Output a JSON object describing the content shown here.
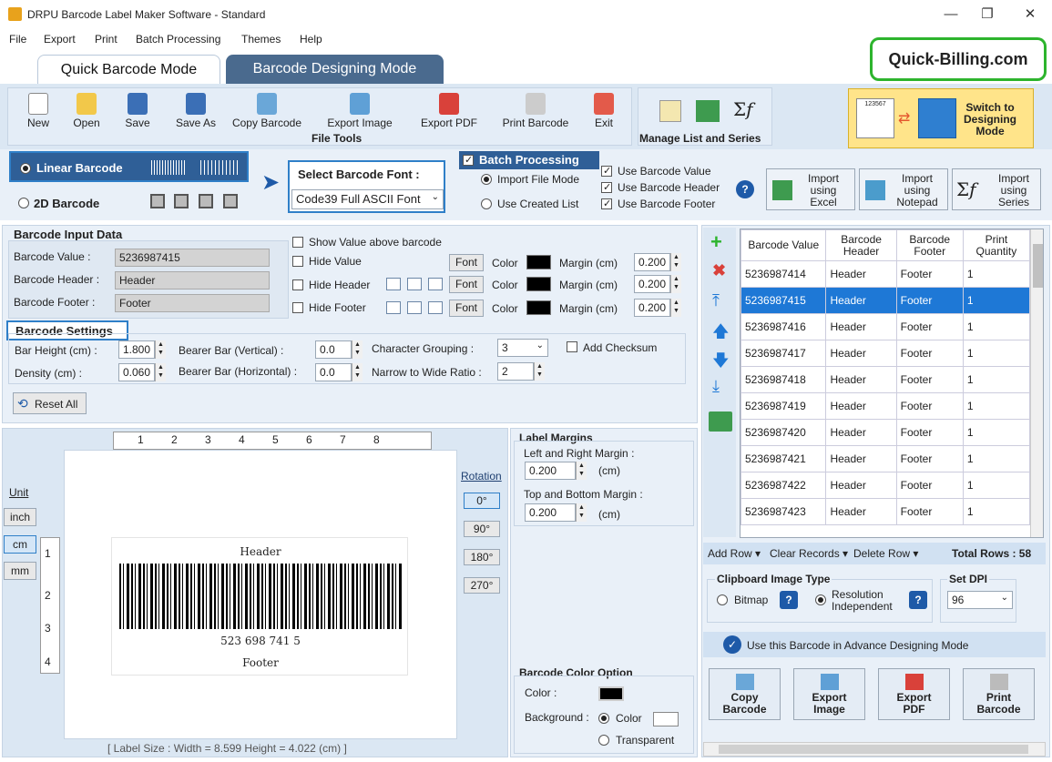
{
  "window": {
    "title": "DRPU Barcode Label Maker Software - Standard"
  },
  "menu": [
    "File",
    "Export",
    "Print",
    "Batch Processing",
    "Themes",
    "Help"
  ],
  "tabs": {
    "quick": "Quick Barcode Mode",
    "designing": "Barcode Designing Mode"
  },
  "brand": "Quick-Billing.com",
  "toolbar": {
    "file_tools": [
      "New",
      "Open",
      "Save",
      "Save As",
      "Copy Barcode",
      "Export Image",
      "Export PDF",
      "Print Barcode",
      "Exit"
    ],
    "file_tools_label": "File Tools",
    "manage_label": "Manage List and Series",
    "switch_label": "Switch to Designing Mode",
    "switch_thumb_value": "123567"
  },
  "type": {
    "linear": "Linear Barcode",
    "two_d": "2D Barcode",
    "selected": "Linear Barcode"
  },
  "font": {
    "label": "Select Barcode Font :",
    "value": "Code39 Full ASCII Font"
  },
  "batch": {
    "title": "Batch Processing",
    "import_file": "Import File Mode",
    "use_created": "Use Created List",
    "use_value": "Use Barcode Value",
    "use_header": "Use Barcode Header",
    "use_footer": "Use Barcode Footer",
    "help": "?",
    "import_excel": "Import using Excel",
    "import_notepad": "Import using Notepad",
    "import_series": "Import using Series"
  },
  "input": {
    "title": "Barcode Input Data",
    "value_label": "Barcode Value :",
    "value": "5236987415",
    "header_label": "Barcode Header :",
    "header": "Header",
    "footer_label": "Barcode Footer :",
    "footer": "Footer",
    "show_above": "Show Value above barcode",
    "hide_value": "Hide Value",
    "hide_header": "Hide Header",
    "hide_footer": "Hide Footer",
    "font_btn": "Font",
    "color_lbl": "Color",
    "margin_lbl": "Margin (cm)",
    "margins": [
      "0.200",
      "0.200",
      "0.200"
    ]
  },
  "settings": {
    "title": "Barcode Settings",
    "bar_height_lbl": "Bar Height (cm) :",
    "bar_height": "1.800",
    "density_lbl": "Density (cm) :",
    "density": "0.060",
    "bearer_v_lbl": "Bearer Bar (Vertical) :",
    "bearer_v": "0.0",
    "bearer_h_lbl": "Bearer Bar (Horizontal) :",
    "bearer_h": "0.0",
    "grouping_lbl": "Character Grouping :",
    "grouping": "3",
    "ratio_lbl": "Narrow to Wide Ratio :",
    "ratio": "2",
    "checksum": "Add Checksum",
    "reset": "Reset All"
  },
  "canvas": {
    "unit_lbl": "Unit",
    "units": [
      "inch",
      "cm",
      "mm"
    ],
    "active_unit": "cm",
    "ruler_h": [
      "1",
      "2",
      "3",
      "4",
      "5",
      "6",
      "7",
      "8"
    ],
    "ruler_v": [
      "1",
      "2",
      "3",
      "4"
    ],
    "rotation_lbl": "Rotation",
    "rotations": [
      "0°",
      "90°",
      "180°",
      "270°"
    ],
    "label_header": "Header",
    "label_value": "523 698 741 5",
    "label_footer": "Footer",
    "status": "[ Label Size : Width = 8.599  Height = 4.022 (cm) ]"
  },
  "margins": {
    "title": "Label Margins",
    "lr_lbl": "Left and Right Margin :",
    "lr": "0.200",
    "lr_unit": "(cm)",
    "tb_lbl": "Top and Bottom Margin :",
    "tb": "0.200",
    "tb_unit": "(cm)"
  },
  "coloropt": {
    "title": "Barcode Color Option",
    "color_lbl": "Color :",
    "bg_lbl": "Background :",
    "bg_color": "Color",
    "bg_transparent": "Transparent"
  },
  "table": {
    "headers": [
      "Barcode Value",
      "Barcode Header",
      "Barcode Footer",
      "Print Quantity"
    ],
    "rows": [
      [
        "5236987414",
        "Header",
        "Footer",
        "1"
      ],
      [
        "5236987415",
        "Header",
        "Footer",
        "1"
      ],
      [
        "5236987416",
        "Header",
        "Footer",
        "1"
      ],
      [
        "5236987417",
        "Header",
        "Footer",
        "1"
      ],
      [
        "5236987418",
        "Header",
        "Footer",
        "1"
      ],
      [
        "5236987419",
        "Header",
        "Footer",
        "1"
      ],
      [
        "5236987420",
        "Header",
        "Footer",
        "1"
      ],
      [
        "5236987421",
        "Header",
        "Footer",
        "1"
      ],
      [
        "5236987422",
        "Header",
        "Footer",
        "1"
      ],
      [
        "5236987423",
        "Header",
        "Footer",
        "1"
      ]
    ],
    "selected_index": 1,
    "add_row": "Add Row",
    "clear": "Clear Records",
    "delete_row": "Delete Row",
    "total": "Total Rows : 58"
  },
  "clipboard": {
    "title": "Clipboard Image Type",
    "bitmap": "Bitmap",
    "resolution": "Resolution Independent",
    "dpi_lbl": "Set DPI",
    "dpi": "96"
  },
  "advance": "Use this Barcode in Advance Designing Mode",
  "actions": [
    "Copy Barcode",
    "Export Image",
    "Export PDF",
    "Print Barcode"
  ]
}
